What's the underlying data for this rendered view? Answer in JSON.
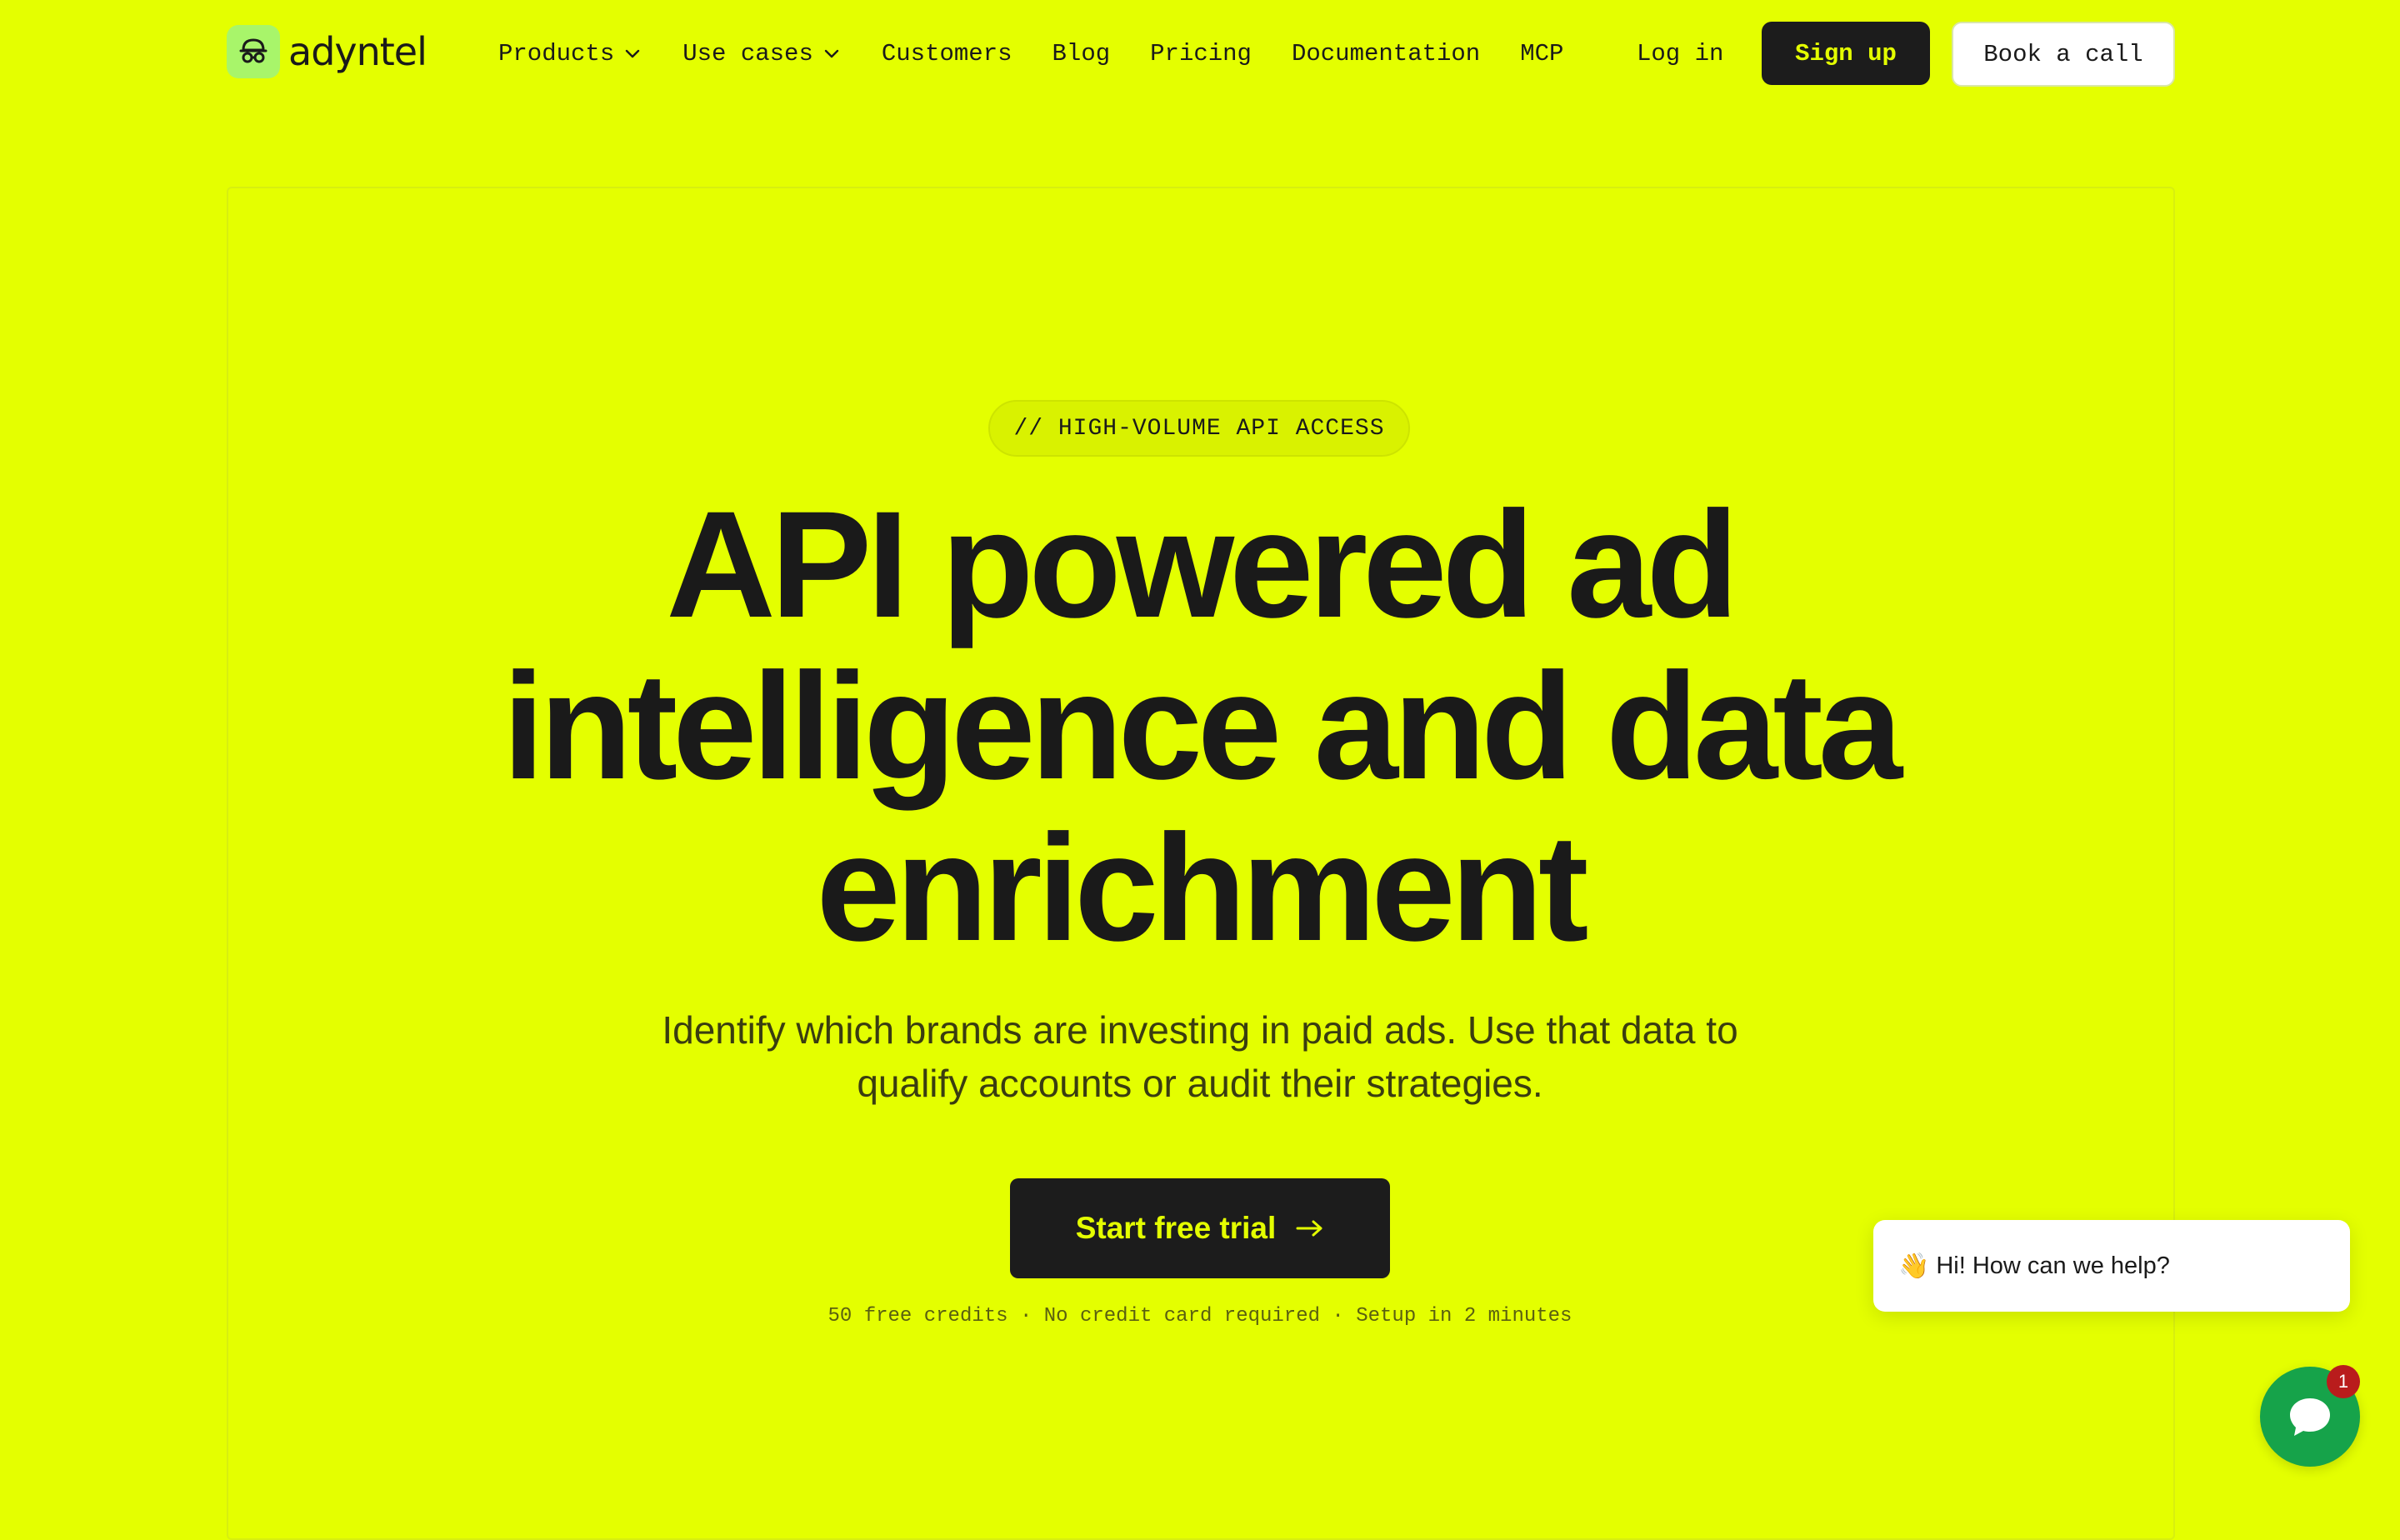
{
  "brand": {
    "name": "adyntel",
    "accent": "#e4ff00",
    "dark": "#1c1c1c"
  },
  "nav": {
    "items": [
      {
        "label": "Products",
        "dropdown": true
      },
      {
        "label": "Use cases",
        "dropdown": true
      },
      {
        "label": "Customers",
        "dropdown": false
      },
      {
        "label": "Blog",
        "dropdown": false
      },
      {
        "label": "Pricing",
        "dropdown": false
      },
      {
        "label": "Documentation",
        "dropdown": false
      },
      {
        "label": "MCP",
        "dropdown": false
      }
    ],
    "login": "Log in",
    "signup": "Sign up",
    "book_call": "Book a call"
  },
  "hero": {
    "eyebrow": "// HIGH-VOLUME API ACCESS",
    "headline_lines": [
      "API powered ad",
      "intelligence and data",
      "enrichment"
    ],
    "subtitle_lines": [
      "Identify which brands are investing in paid ads. Use that data to",
      "qualify accounts or audit their strategies."
    ],
    "cta_label": "Start free trial",
    "fineprint": "50 free credits · No credit card required · Setup in 2 minutes"
  },
  "chat": {
    "greeting_emoji": "👋",
    "greeting": "Hi! How can we help?",
    "badge_count": "1",
    "launcher_color": "#16a34a"
  }
}
